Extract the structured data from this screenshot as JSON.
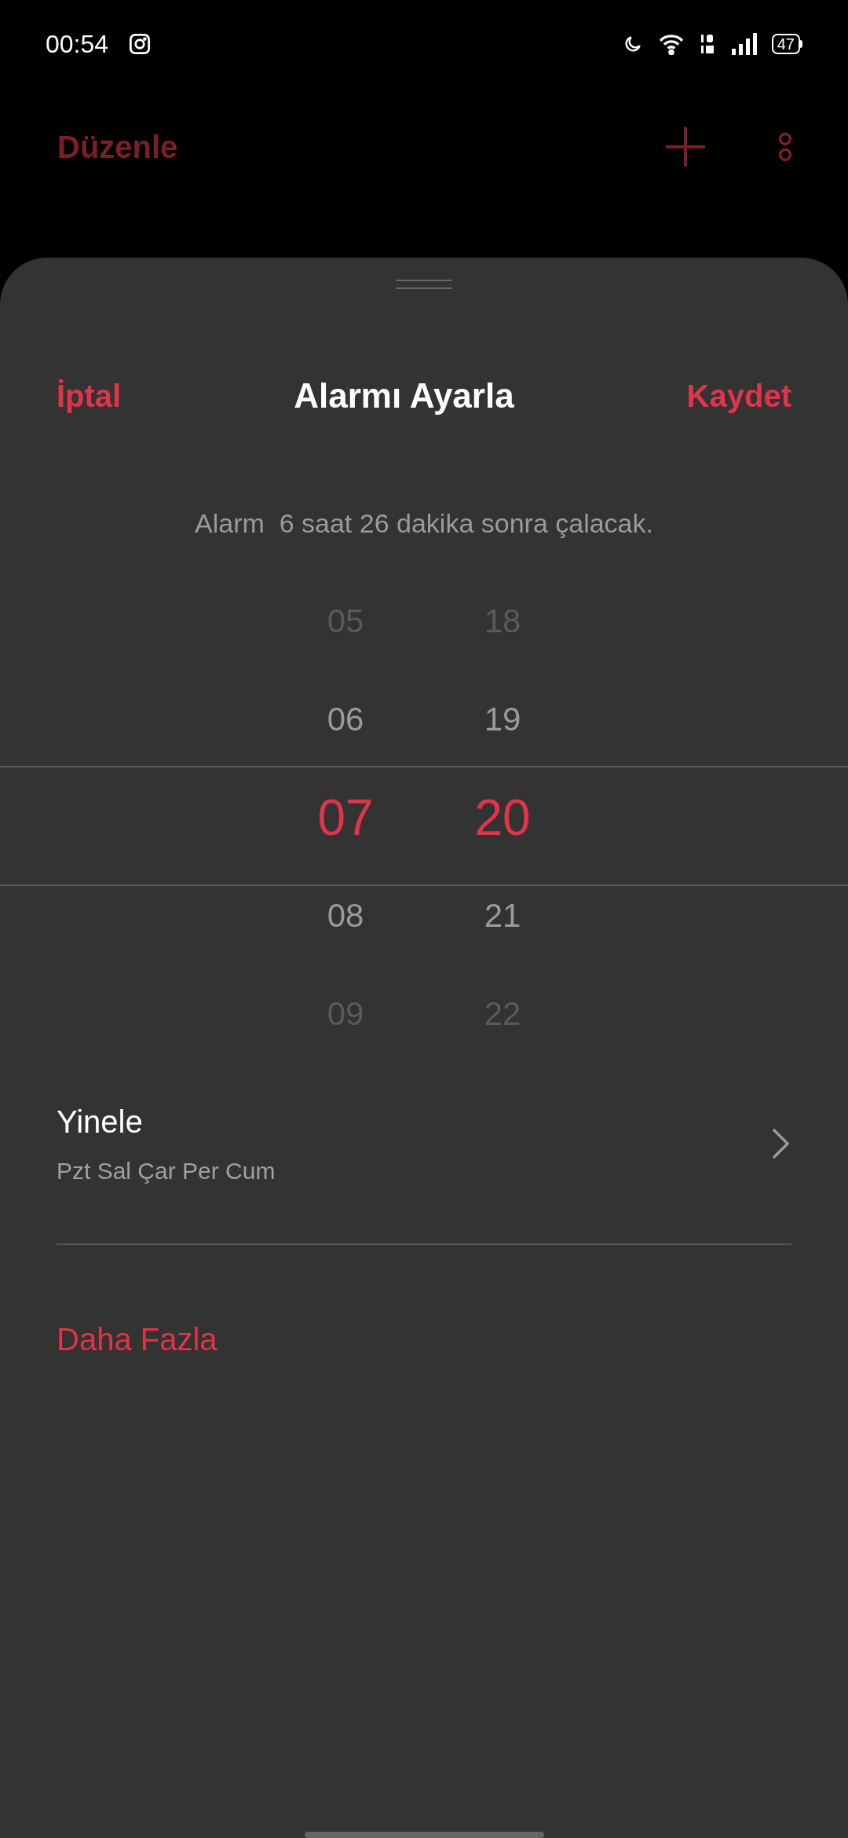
{
  "status_bar": {
    "time": "00:54",
    "battery": "47"
  },
  "toolbar": {
    "edit": "Düzenle"
  },
  "sheet": {
    "cancel": "İptal",
    "title": "Alarmı Ayarla",
    "save": "Kaydet",
    "info": "Alarm  6 saat 26 dakika sonra çalacak.",
    "hours": [
      {
        "label": "05",
        "selected": false
      },
      {
        "label": "06",
        "selected": false
      },
      {
        "label": "07",
        "selected": true
      },
      {
        "label": "08",
        "selected": false
      },
      {
        "label": "09",
        "selected": false
      }
    ],
    "minutes": [
      {
        "label": "18",
        "selected": false
      },
      {
        "label": "19",
        "selected": false
      },
      {
        "label": "20",
        "selected": true
      },
      {
        "label": "21",
        "selected": false
      },
      {
        "label": "22",
        "selected": false
      }
    ],
    "repeat": {
      "title": "Yinele",
      "days": "Pzt Sal Çar Per Cum"
    },
    "more": "Daha Fazla"
  }
}
